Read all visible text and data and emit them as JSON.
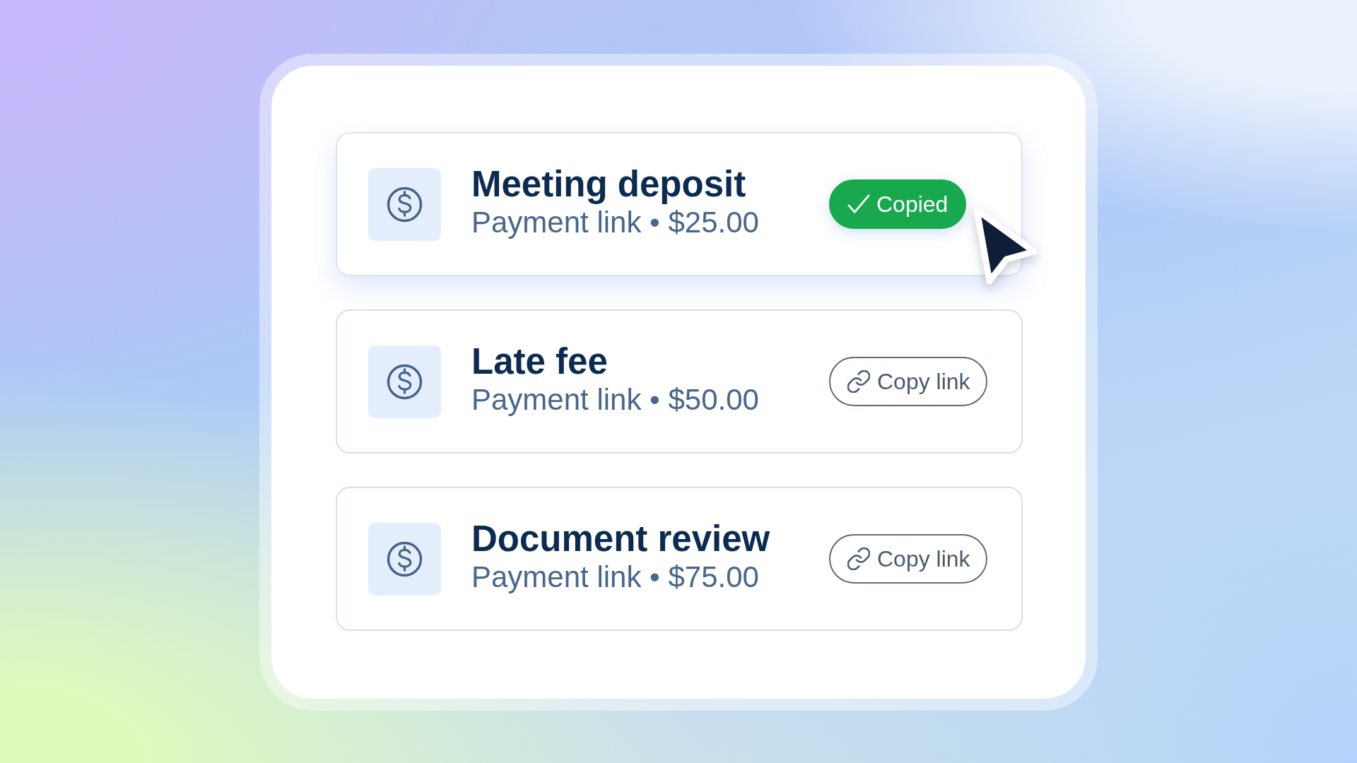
{
  "payment_links": [
    {
      "title": "Meeting deposit",
      "details": "Payment link • $25.00",
      "hovered": true,
      "copied": true,
      "action": "Copied"
    },
    {
      "title": "Late fee",
      "details": "Payment link • $50.00",
      "hovered": false,
      "copied": false,
      "action": "Copy link"
    },
    {
      "title": "Document review",
      "details": "Payment link • $75.00",
      "hovered": false,
      "copied": false,
      "action": "Copy link"
    }
  ]
}
